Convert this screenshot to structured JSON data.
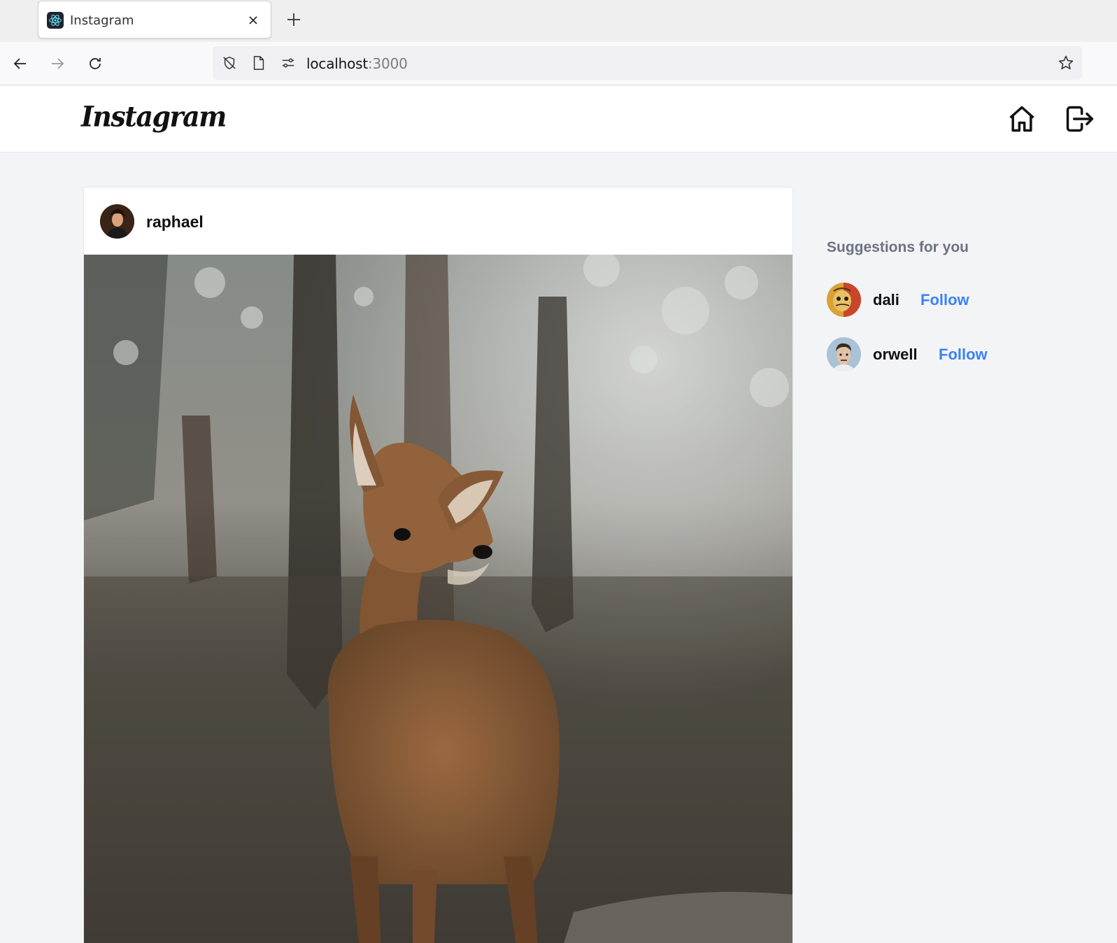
{
  "browser": {
    "tab_title": "Instagram",
    "url_host": "localhost",
    "url_port": ":3000"
  },
  "header": {
    "logo": "Instagram"
  },
  "post": {
    "username": "raphael"
  },
  "suggestions": {
    "title": "Suggestions for you",
    "users": [
      {
        "name": "dali",
        "action": "Follow"
      },
      {
        "name": "orwell",
        "action": "Follow"
      }
    ]
  },
  "colors": {
    "accent": "#3b82f6",
    "muted": "#6b7280",
    "page_bg": "#f3f4f6"
  }
}
